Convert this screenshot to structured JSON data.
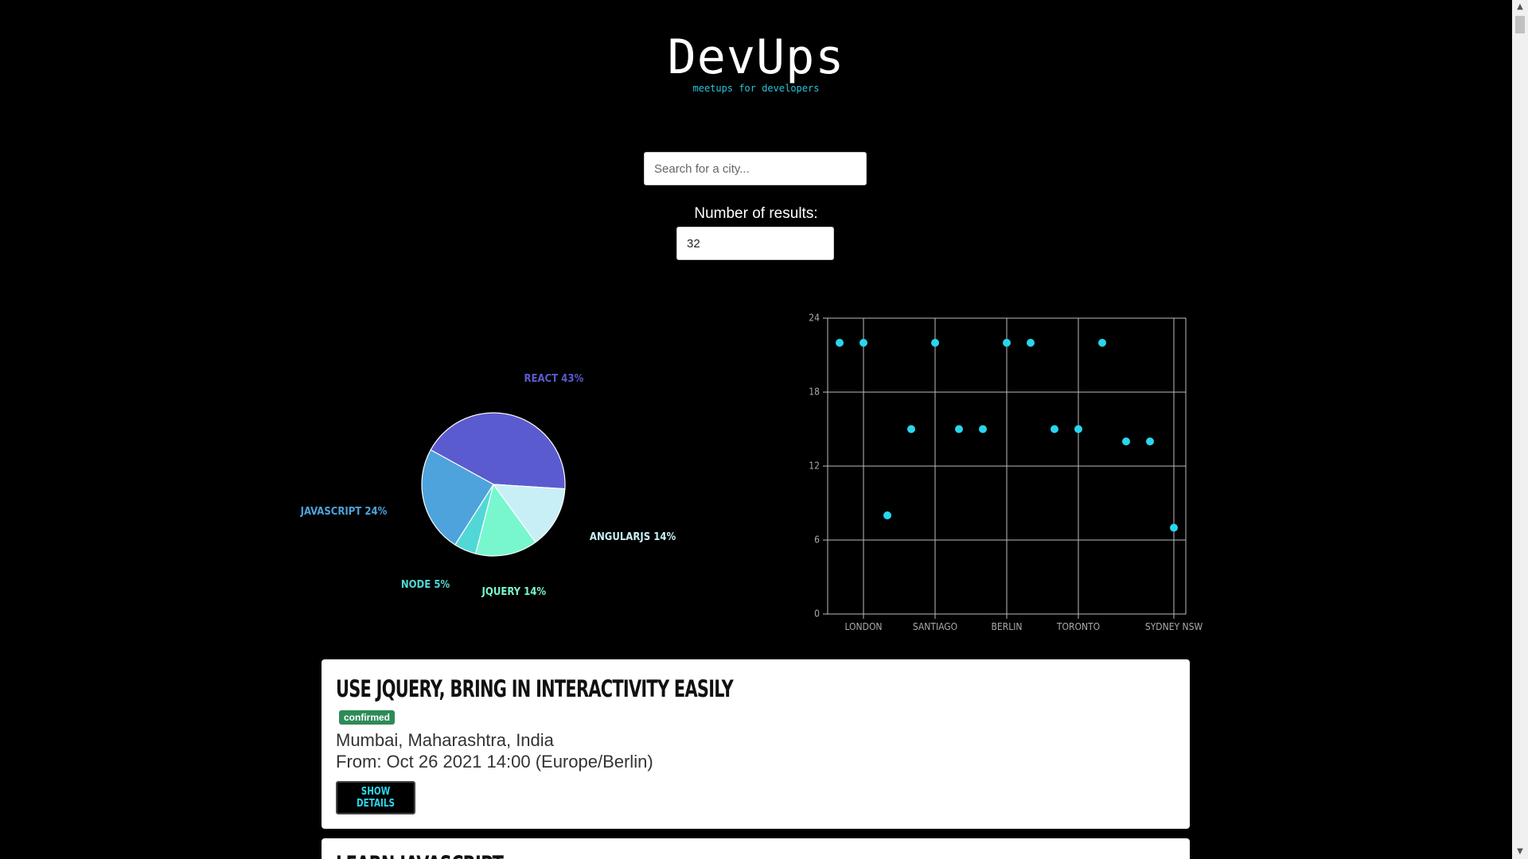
{
  "header": {
    "title": "DevUps",
    "subtitle": "meetups for developers"
  },
  "search": {
    "placeholder": "Search for a city..."
  },
  "results": {
    "label": "Number of results:",
    "value": "32"
  },
  "chart_data": [
    {
      "type": "pie",
      "series": [
        {
          "name": "REACT",
          "label": "REACT 43%",
          "value": 43,
          "color": "#5b5bd0"
        },
        {
          "name": "ANGULARJS",
          "label": "ANGULARJS 14%",
          "value": 14,
          "color": "#c9eff6"
        },
        {
          "name": "JQUERY",
          "label": "JQUERY 14%",
          "value": 14,
          "color": "#78f7cf"
        },
        {
          "name": "NODE",
          "label": "NODE 5%",
          "value": 5,
          "color": "#52d7d7"
        },
        {
          "name": "JAVASCRIPT",
          "label": "JAVASCRIPT 24%",
          "value": 24,
          "color": "#4ea3dc"
        }
      ]
    },
    {
      "type": "scatter",
      "ylim": [
        0,
        24
      ],
      "yticks": [
        "0",
        "6",
        "12",
        "18",
        "24"
      ],
      "xtick_labels": [
        "LONDON",
        "SANTIAGO",
        "BERLIN",
        "TORONTO",
        "SYDNEY NSW"
      ],
      "point_color": "#29d6ec",
      "points": [
        {
          "x": 0,
          "y": 22
        },
        {
          "x": 1,
          "y": 22
        },
        {
          "x": 2,
          "y": 8
        },
        {
          "x": 3,
          "y": 15
        },
        {
          "x": 4,
          "y": 22
        },
        {
          "x": 5,
          "y": 15
        },
        {
          "x": 6,
          "y": 15
        },
        {
          "x": 7,
          "y": 22
        },
        {
          "x": 8,
          "y": 22
        },
        {
          "x": 9,
          "y": 15
        },
        {
          "x": 10,
          "y": 15
        },
        {
          "x": 11,
          "y": 22
        },
        {
          "x": 12,
          "y": 14
        },
        {
          "x": 13,
          "y": 14
        },
        {
          "x": 14,
          "y": 7
        }
      ]
    }
  ],
  "events": [
    {
      "title": "Use jQuery, bring in interactivity easily",
      "badge": "confirmed",
      "location": "Mumbai, Maharashtra, India",
      "from": "From: Oct 26 2021 14:00 (Europe/Berlin)",
      "button": "Show details"
    },
    {
      "title": "Learn JavaScript"
    }
  ]
}
